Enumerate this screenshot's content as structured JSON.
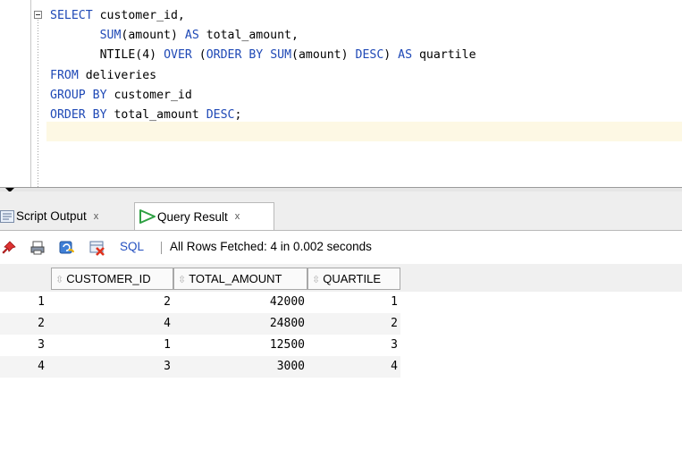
{
  "editor": {
    "lines": [
      [
        "kw:SELECT",
        "txt: customer_id,"
      ],
      [
        "txt:       ",
        "kw:SUM",
        "txt:(amount) ",
        "kw:AS",
        "txt: total_amount,"
      ],
      [
        "txt:       NTILE(",
        "num:4",
        "txt:) ",
        "kw:OVER",
        "txt: (",
        "kw:ORDER BY",
        "txt: ",
        "kw:SUM",
        "txt:(amount) ",
        "kw:DESC",
        "txt:) ",
        "kw:AS",
        "txt: quartile"
      ],
      [
        "kw:FROM",
        "txt: deliveries"
      ],
      [
        "kw:GROUP BY",
        "txt: customer_id"
      ],
      [
        "kw:ORDER BY",
        "txt: total_amount ",
        "kw:DESC",
        "txt:;"
      ]
    ]
  },
  "tabs": {
    "script_output": "Script Output",
    "query_result": "Query Result",
    "close_glyph": "x"
  },
  "toolbar": {
    "sql_label": "SQL",
    "separator": "|",
    "status": "All Rows Fetched: 4 in 0.002 seconds"
  },
  "grid": {
    "columns": [
      "CUSTOMER_ID",
      "TOTAL_AMOUNT",
      "QUARTILE"
    ],
    "rows": [
      {
        "num": "1",
        "customer_id": "2",
        "total_amount": "42000",
        "quartile": "1"
      },
      {
        "num": "2",
        "customer_id": "4",
        "total_amount": "24800",
        "quartile": "2"
      },
      {
        "num": "3",
        "customer_id": "1",
        "total_amount": "12500",
        "quartile": "3"
      },
      {
        "num": "4",
        "customer_id": "3",
        "total_amount": "3000",
        "quartile": "4"
      }
    ]
  },
  "colors": {
    "keyword": "#1f49b6",
    "current_line": "#fdf8e4",
    "play_icon": "#2ea043"
  }
}
